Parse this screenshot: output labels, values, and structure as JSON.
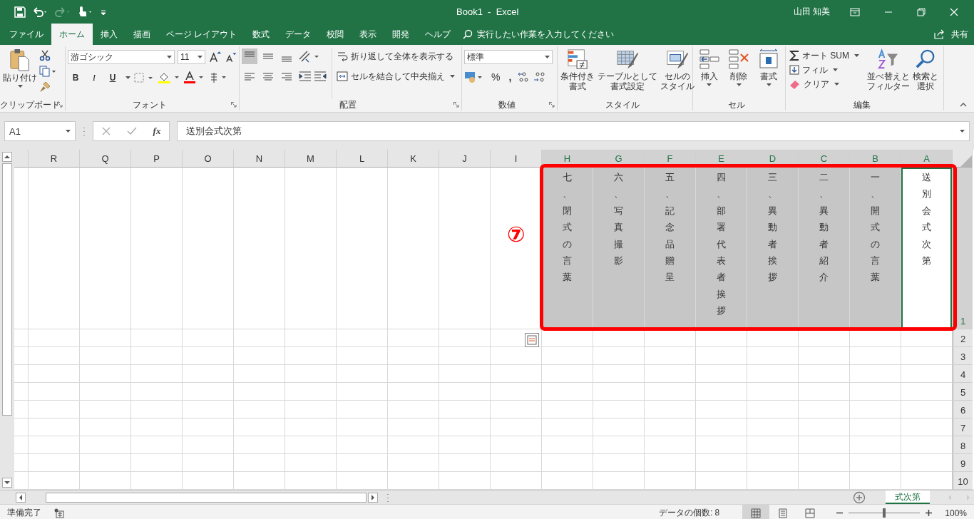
{
  "window": {
    "title": "Book1  -  Excel",
    "user": "山田 知美"
  },
  "tabs": [
    {
      "label": "ファイル",
      "selected": false
    },
    {
      "label": "ホーム",
      "selected": true
    },
    {
      "label": "挿入",
      "selected": false
    },
    {
      "label": "描画",
      "selected": false
    },
    {
      "label": "ページ レイアウト",
      "selected": false
    },
    {
      "label": "数式",
      "selected": false
    },
    {
      "label": "データ",
      "selected": false
    },
    {
      "label": "校閲",
      "selected": false
    },
    {
      "label": "表示",
      "selected": false
    },
    {
      "label": "開発",
      "selected": false
    },
    {
      "label": "ヘルプ",
      "selected": false
    }
  ],
  "tell_me": {
    "placeholder": "実行したい作業を入力してください"
  },
  "share": "共有",
  "ribbon": {
    "clipboard": {
      "paste": "貼り付け",
      "label": "クリップボード"
    },
    "font": {
      "name": "游ゴシック",
      "size": "11",
      "bold": "B",
      "italic": "I",
      "underline": "U",
      "label": "フォント"
    },
    "alignment": {
      "vertical_buttons": [
        {
          "selected": true
        },
        {
          "selected": false
        },
        {
          "selected": false
        }
      ],
      "wrap": "折り返して全体を表示する",
      "merge": "セルを結合して中央揃え",
      "label": "配置"
    },
    "number": {
      "format": "標準",
      "percent": "%",
      "comma": ",",
      "label": "数値"
    },
    "styles": {
      "conditional": [
        "条件付き",
        "書式"
      ],
      "table": [
        "テーブルとして",
        "書式設定"
      ],
      "cell": [
        "セルの",
        "スタイル"
      ],
      "label": "スタイル"
    },
    "cells": {
      "insert": "挿入",
      "delete": "削除",
      "format": "書式",
      "label": "セル"
    },
    "editing": {
      "autosum": "オート SUM",
      "fill": "フィル",
      "clear": "クリア",
      "sort": [
        "並べ替えと",
        "フィルター"
      ],
      "find": [
        "検索と",
        "選択"
      ],
      "label": "編集"
    }
  },
  "formula_bar": {
    "name_box": "A1",
    "function_label": "fx",
    "value": "送別会式次第"
  },
  "sheet": {
    "columns": [
      {
        "letter": "R",
        "selected": false,
        "active": false
      },
      {
        "letter": "Q",
        "selected": false,
        "active": false
      },
      {
        "letter": "P",
        "selected": false,
        "active": false
      },
      {
        "letter": "O",
        "selected": false,
        "active": false
      },
      {
        "letter": "N",
        "selected": false,
        "active": false
      },
      {
        "letter": "M",
        "selected": false,
        "active": false
      },
      {
        "letter": "L",
        "selected": false,
        "active": false
      },
      {
        "letter": "K",
        "selected": false,
        "active": false
      },
      {
        "letter": "J",
        "selected": false,
        "active": false
      },
      {
        "letter": "I",
        "selected": false,
        "active": false
      },
      {
        "letter": "H",
        "selected": true,
        "active": false,
        "cell": "七、閉式の言葉"
      },
      {
        "letter": "G",
        "selected": true,
        "active": false,
        "cell": "六、写真撮影"
      },
      {
        "letter": "F",
        "selected": true,
        "active": false,
        "cell": "五、記念品贈呈"
      },
      {
        "letter": "E",
        "selected": true,
        "active": false,
        "cell": "四、部署代表者挨拶"
      },
      {
        "letter": "D",
        "selected": true,
        "active": false,
        "cell": "三、異動者挨拶"
      },
      {
        "letter": "C",
        "selected": true,
        "active": false,
        "cell": "二、異動者紹介"
      },
      {
        "letter": "B",
        "selected": true,
        "active": false,
        "cell": "一、開式の言葉"
      },
      {
        "letter": "A",
        "selected": true,
        "active": true,
        "cell": "送別会式次第"
      }
    ],
    "rows": [
      {
        "number": "1",
        "selected": true
      },
      {
        "number": "2",
        "selected": false
      },
      {
        "number": "3",
        "selected": false
      },
      {
        "number": "4",
        "selected": false
      },
      {
        "number": "5",
        "selected": false
      },
      {
        "number": "6",
        "selected": false
      },
      {
        "number": "7",
        "selected": false
      },
      {
        "number": "8",
        "selected": false
      },
      {
        "number": "9",
        "selected": false
      },
      {
        "number": "10",
        "selected": false
      }
    ]
  },
  "annotation": {
    "marker": "⑦"
  },
  "sheet_tabs": [
    {
      "label": "式次第",
      "selected": true
    }
  ],
  "status_bar": {
    "mode": "準備完了",
    "count": "データの個数: 8",
    "view_buttons": [
      {
        "selected": true
      },
      {
        "selected": false
      },
      {
        "selected": false
      }
    ],
    "zoom": {
      "level": 0.5
    },
    "zoom_label": "100%"
  }
}
